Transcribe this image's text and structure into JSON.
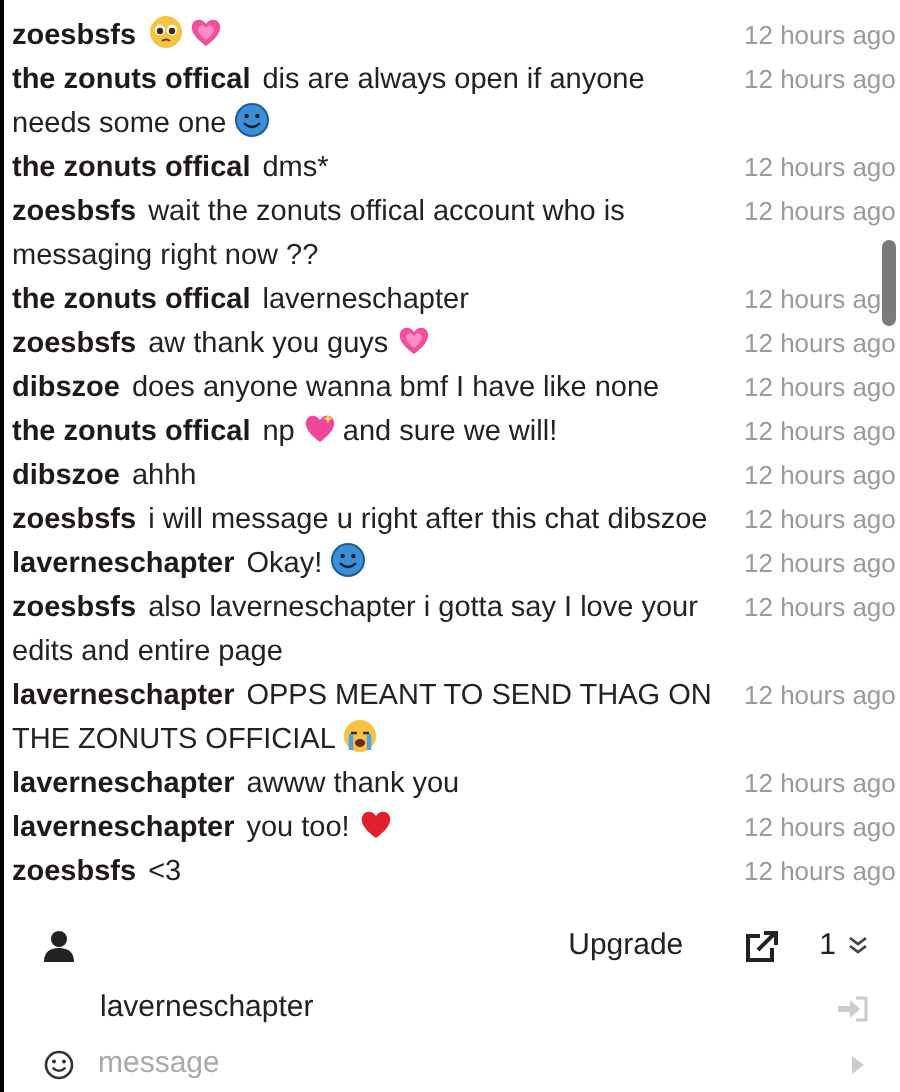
{
  "messages": [
    {
      "author": "zoesbsfs",
      "time": "12 hours ago",
      "parts": [
        {
          "kind": "pleading"
        },
        {
          "kind": "growing-heart"
        }
      ]
    },
    {
      "author": "the zonuts offical",
      "time": "12 hours ago",
      "parts": [
        {
          "kind": "text",
          "text": "dis are always open if anyone"
        },
        {
          "kind": "text",
          "text": "needs some one"
        },
        {
          "kind": "smile"
        }
      ]
    },
    {
      "author": "the zonuts offical",
      "time": "12 hours ago",
      "parts": [
        {
          "kind": "text",
          "text": "dms*"
        }
      ]
    },
    {
      "author": "zoesbsfs",
      "time": "12 hours ago",
      "parts": [
        {
          "kind": "text",
          "text": "wait the zonuts offical account who is"
        },
        {
          "kind": "text",
          "text": "messaging right now ??"
        }
      ]
    },
    {
      "author": "the zonuts offical",
      "time": "12 hours ag",
      "parts": [
        {
          "kind": "text",
          "text": "laverneschapter"
        }
      ]
    },
    {
      "author": "zoesbsfs",
      "time": "12 hours ago",
      "parts": [
        {
          "kind": "text",
          "text": "aw thank you guys"
        },
        {
          "kind": "growing-heart"
        }
      ]
    },
    {
      "author": "dibszoe",
      "time": "12 hours ago",
      "parts": [
        {
          "kind": "text",
          "text": "does anyone wanna bmf I have like none"
        }
      ]
    },
    {
      "author": "the zonuts offical",
      "time": "12 hours ago",
      "parts": [
        {
          "kind": "text",
          "text": "np"
        },
        {
          "kind": "sparkle-heart"
        },
        {
          "kind": "text",
          "text": "and sure we will!"
        }
      ]
    },
    {
      "author": "dibszoe",
      "time": "12 hours ago",
      "parts": [
        {
          "kind": "text",
          "text": "ahhh"
        }
      ]
    },
    {
      "author": "zoesbsfs",
      "time": "12 hours ago",
      "parts": [
        {
          "kind": "text",
          "text": "i will message u right after this chat dibszoe"
        }
      ]
    },
    {
      "author": "laverneschapter",
      "time": "12 hours ago",
      "parts": [
        {
          "kind": "text",
          "text": "Okay!"
        },
        {
          "kind": "smile"
        }
      ]
    },
    {
      "author": "zoesbsfs",
      "time": "12 hours ago",
      "parts": [
        {
          "kind": "text",
          "text": "also laverneschapter i gotta say I love your"
        },
        {
          "kind": "text",
          "text": "edits and entire page"
        }
      ]
    },
    {
      "author": "laverneschapter",
      "time": "12 hours ago",
      "parts": [
        {
          "kind": "text",
          "text": "OPPS MEANT TO SEND THAG ON"
        },
        {
          "kind": "text",
          "text": "THE ZONUTS OFFICIAL"
        },
        {
          "kind": "sob"
        }
      ]
    },
    {
      "author": "laverneschapter",
      "time": "12 hours ago",
      "parts": [
        {
          "kind": "text",
          "text": "awww thank you"
        }
      ]
    },
    {
      "author": "laverneschapter",
      "time": "12 hours ago",
      "parts": [
        {
          "kind": "text",
          "text": "you too!"
        },
        {
          "kind": "red-heart"
        }
      ]
    },
    {
      "author": "zoesbsfs",
      "time": "12 hours ago",
      "parts": [
        {
          "kind": "text",
          "text": "<3"
        }
      ]
    }
  ],
  "footer": {
    "upgrade": "Upgrade",
    "count": "1",
    "username": "laverneschapter",
    "message_placeholder": "message"
  }
}
